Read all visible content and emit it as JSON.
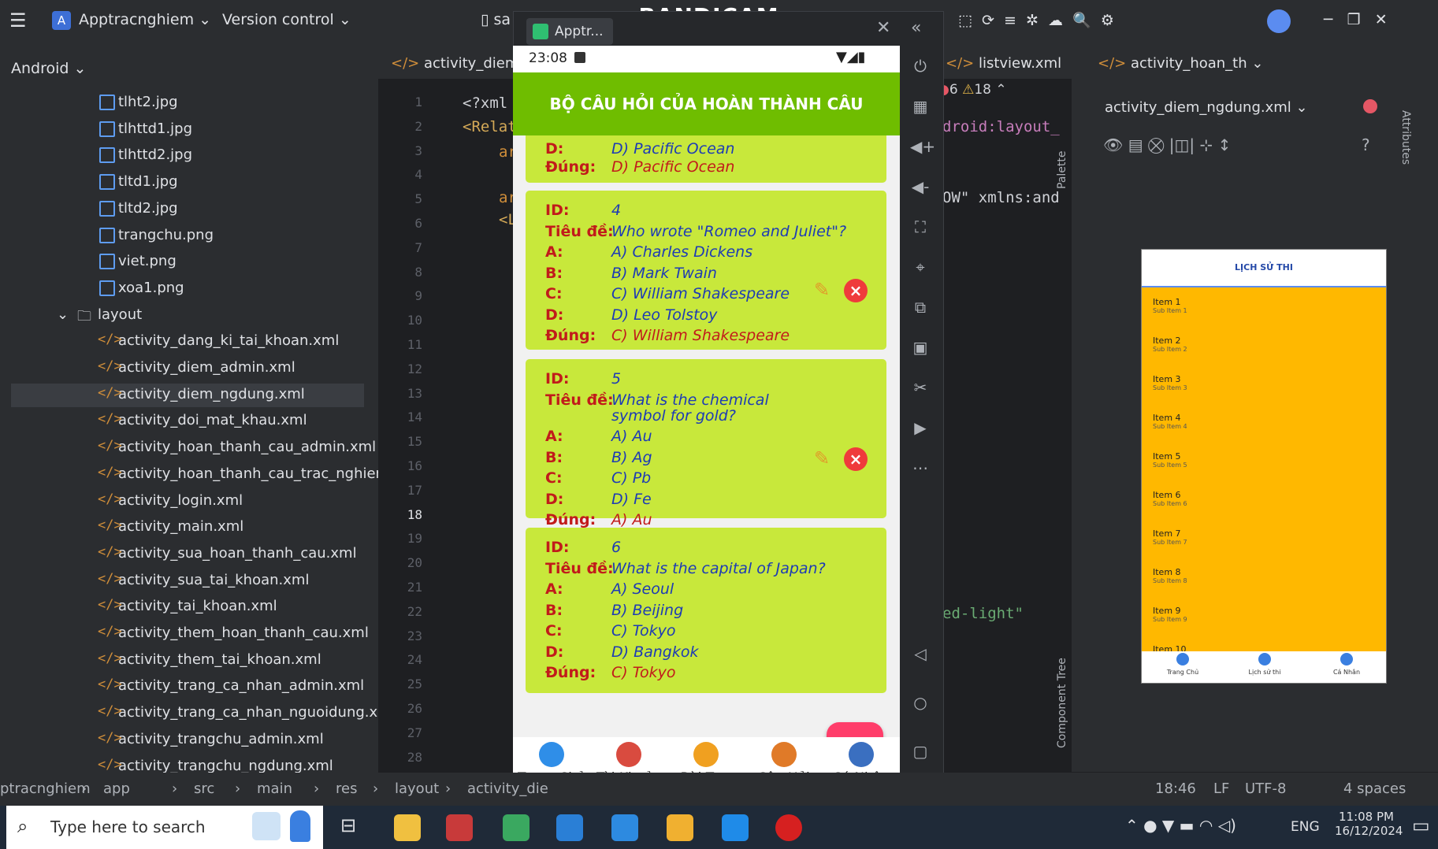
{
  "watermark": "www.BANDICAM.com",
  "ide": {
    "project_name": "Apptracnghiem",
    "vcs_label": "Version control",
    "panel_title": "Android",
    "tree_files": [
      "tlht2.jpg",
      "tlhttd1.jpg",
      "tlhttd2.jpg",
      "tltd1.jpg",
      "tltd2.jpg",
      "trangchu.png",
      "viet.png",
      "xoa1.png"
    ],
    "layout_folder": "layout",
    "layout_files": [
      "activity_dang_ki_tai_khoan.xml",
      "activity_diem_admin.xml",
      "activity_diem_ngdung.xml",
      "activity_doi_mat_khau.xml",
      "activity_hoan_thanh_cau_admin.xml",
      "activity_hoan_thanh_cau_trac_nghiem",
      "activity_login.xml",
      "activity_main.xml",
      "activity_sua_hoan_thanh_cau.xml",
      "activity_sua_tai_khoan.xml",
      "activity_tai_khoan.xml",
      "activity_them_hoan_thanh_cau.xml",
      "activity_them_tai_khoan.xml",
      "activity_trang_ca_nhan_admin.xml",
      "activity_trang_ca_nhan_nguoidung.xm",
      "activity_trangchu_admin.xml",
      "activity_trangchu_ngdung.xml"
    ],
    "tabs": [
      "activity_diem_",
      "listview.xml",
      "activity_hoan_th"
    ],
    "design_tab": "activity_diem_ngdung.xml",
    "line_numbers": [
      "1",
      "2",
      "3",
      "4",
      "5",
      "6",
      "7",
      "8",
      "9",
      "10",
      "11",
      "12",
      "13",
      "14",
      "15",
      "16",
      "17",
      "18",
      "19",
      "20",
      "21",
      "22",
      "23",
      "24",
      "25",
      "26",
      "27",
      "28"
    ],
    "code_lines": [
      "<?xml",
      "<Relat",
      "ar",
      "",
      "ar",
      "<L"
    ],
    "code_right": [
      "droid:layout_",
      "OW\" xmlns:and",
      "ed-light\""
    ],
    "inspection": {
      "errors": "6",
      "warnings": "18"
    },
    "palette_label": "Palette",
    "component_tree_label": "Component Tree",
    "attributes_label": "Attributes",
    "preview_header": "LỊCH SỬ THI",
    "preview_items": [
      {
        "title": "Item 1",
        "sub": "Sub Item 1"
      },
      {
        "title": "Item 2",
        "sub": "Sub Item 2"
      },
      {
        "title": "Item 3",
        "sub": "Sub Item 3"
      },
      {
        "title": "Item 4",
        "sub": "Sub Item 4"
      },
      {
        "title": "Item 5",
        "sub": "Sub Item 5"
      },
      {
        "title": "Item 6",
        "sub": "Sub Item 6"
      },
      {
        "title": "Item 7",
        "sub": "Sub Item 7"
      },
      {
        "title": "Item 8",
        "sub": "Sub Item 8"
      },
      {
        "title": "Item 9",
        "sub": "Sub Item 9"
      },
      {
        "title": "Item 10",
        "sub": ""
      }
    ],
    "preview_nav": [
      "Trang Chủ",
      "Lịch sử thi",
      "Cá Nhân"
    ],
    "breadcrumb": [
      "ptracnghiem",
      "app",
      "src",
      "main",
      "res",
      "layout",
      "activity_die"
    ],
    "status": {
      "position": "18:46",
      "line_sep": "LF",
      "encoding": "UTF-8",
      "indent": "4 spaces"
    }
  },
  "emulator": {
    "tab_label": "Apptr...",
    "time": "23:08",
    "header": "BỘ CÂU HỎI CỦA HOÀN THÀNH CÂU",
    "labels": {
      "id": "ID:",
      "title": "Tiêu đề:",
      "a": "A:",
      "b": "B:",
      "c": "C:",
      "d": "D:",
      "correct": "Đúng:"
    },
    "partial_card": {
      "d": "D) Pacific Ocean",
      "correct": "D) Pacific Ocean"
    },
    "cards": [
      {
        "id": "4",
        "title": "Who wrote \"Romeo and Juliet\"?",
        "a": "A) Charles Dickens",
        "b": "B) Mark Twain",
        "c": "C) William Shakespeare",
        "d": "D) Leo Tolstoy",
        "correct": "C) William Shakespeare"
      },
      {
        "id": "5",
        "title": "What is the chemical",
        "title2": "symbol for gold?",
        "a": "A) Au",
        "b": "B) Ag",
        "c": "C) Pb",
        "d": "D) Fe",
        "correct": "A) Au"
      },
      {
        "id": "6",
        "title": "What is the capital of Japan?",
        "a": "A) Seoul",
        "b": "B) Beijing",
        "c": "C) Tokyo",
        "d": "D) Bangkok",
        "correct": "C) Tokyo"
      }
    ],
    "fab_label": "+",
    "nav": [
      "Trang Chủ",
      "Tài Khoản",
      "Bài Test",
      "Câu Hỏi",
      "Cá Nhân"
    ]
  },
  "taskbar": {
    "search_placeholder": "Type here to search",
    "lang": "ENG",
    "time": "11:08 PM",
    "date": "16/12/2024"
  },
  "colors": {
    "header_green": "#6fbd00",
    "card_lime": "#c8e83b",
    "label_red": "#c11b1b",
    "value_blue": "#1d3bb5",
    "fab_pink": "#ff3d6a",
    "preview_orange": "#ffb800"
  }
}
